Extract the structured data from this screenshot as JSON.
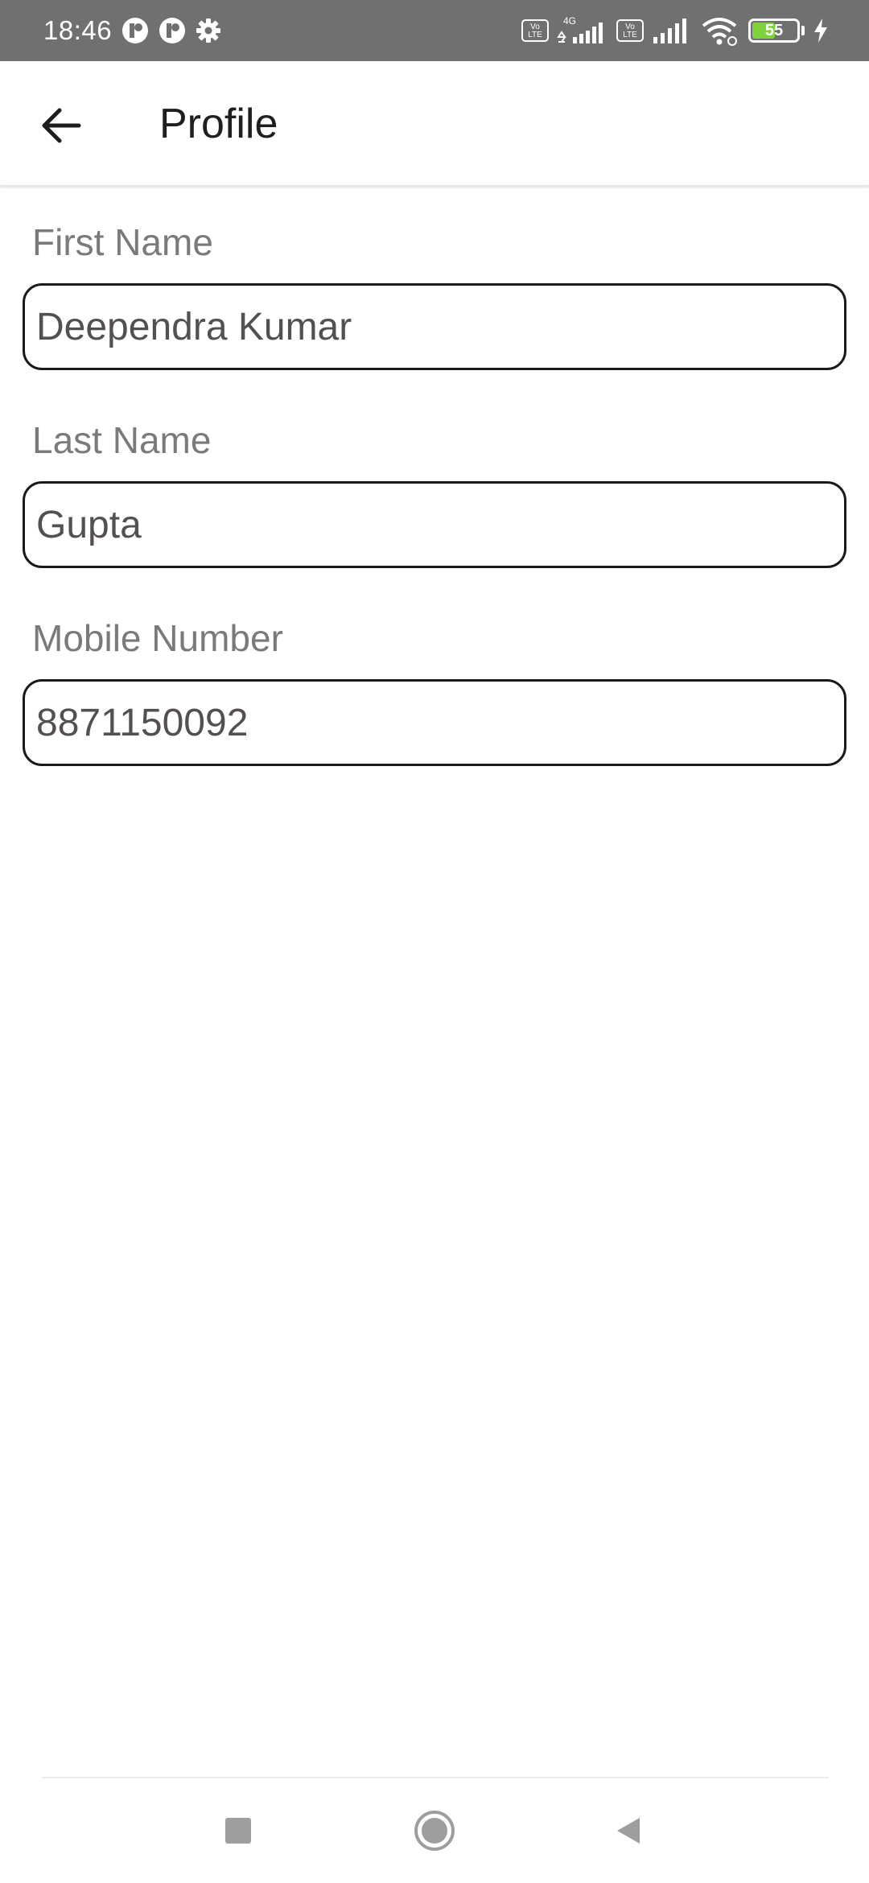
{
  "status_bar": {
    "time": "18:46",
    "battery_level": "55",
    "battery_fraction": 0.55,
    "network_type": "4G",
    "volte_label": "Vo LTE",
    "icons": [
      "app-notification-icon",
      "app-notification-icon",
      "settings-gear-icon",
      "volte-icon",
      "signal-4g-icon",
      "volte-icon",
      "signal-icon",
      "wifi-icon",
      "battery-icon",
      "charging-bolt-icon"
    ]
  },
  "app_bar": {
    "title": "Profile",
    "back_icon": "arrow-left-icon"
  },
  "form": {
    "first_name": {
      "label": "First Name",
      "value": "Deependra Kumar"
    },
    "last_name": {
      "label": "Last Name",
      "value": "Gupta"
    },
    "mobile_number": {
      "label": "Mobile Number",
      "value": "8871150092"
    }
  },
  "nav_bar": {
    "buttons": [
      "recents-square-icon",
      "home-circle-icon",
      "back-triangle-icon"
    ]
  },
  "colors": {
    "status_bar_bg": "#707070",
    "battery_fill": "#7ed23a",
    "label_text": "#7a7a7a",
    "input_text": "#555050",
    "input_border": "#1a1a1a",
    "nav_icon": "#9e9e9e"
  }
}
